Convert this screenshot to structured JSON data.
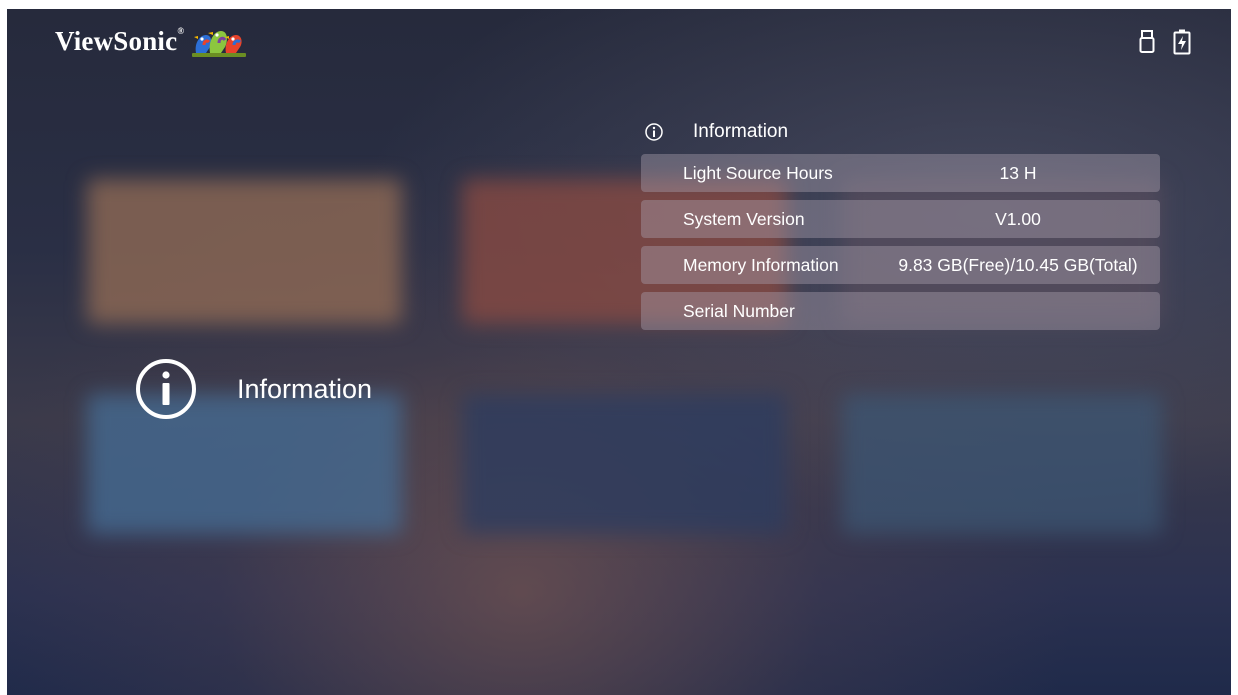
{
  "brand": {
    "name": "ViewSonic",
    "registered_mark": "®"
  },
  "status_bar": {
    "icons": [
      "usb-drive-icon",
      "battery-charging-icon"
    ]
  },
  "current_menu": {
    "icon": "info-circle-icon",
    "label": "Information"
  },
  "info_panel": {
    "title": "Information",
    "title_icon": "info-circle-icon",
    "rows": [
      {
        "label": "Light Source Hours",
        "value": "13 H"
      },
      {
        "label": "System Version",
        "value": "V1.00"
      },
      {
        "label": "Memory Information",
        "value": "9.83 GB(Free)/10.45 GB(Total)"
      },
      {
        "label": "Serial Number",
        "value": ""
      }
    ]
  },
  "colors": {
    "text": "#ffffff",
    "row_background": "#aaa0af"
  }
}
